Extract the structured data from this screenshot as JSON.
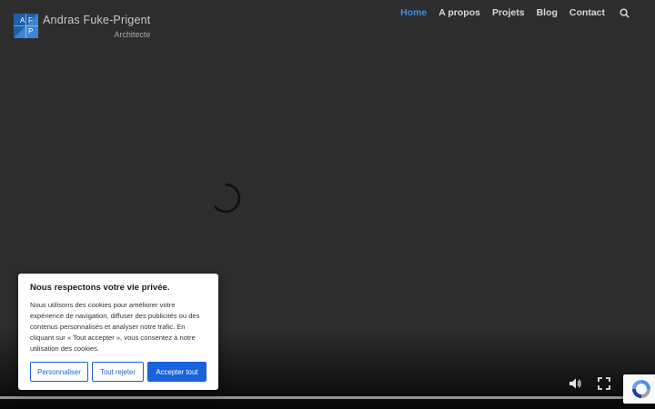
{
  "logo": {
    "mark_letters": [
      "A",
      "F",
      "P"
    ],
    "name": "Andras Fuke-Prigent",
    "subtitle": "Architecte"
  },
  "nav": {
    "items": [
      {
        "label": "Home",
        "active": true
      },
      {
        "label": "A propos",
        "active": false
      },
      {
        "label": "Projets",
        "active": false
      },
      {
        "label": "Blog",
        "active": false
      },
      {
        "label": "Contact",
        "active": false
      }
    ],
    "search_icon": "search-icon",
    "accent_color": "#3f8ee0"
  },
  "video": {
    "state": "loading",
    "controls": [
      "volume-icon",
      "fullscreen-icon"
    ]
  },
  "cookie": {
    "title": "Nous respectons votre vie privée.",
    "text": "Nous utilisons des cookies pour améliorer votre expérience de navigation, diffuser des publicités ou des contenus personnalisés et analyser notre trafic. En cliquant sur « Tout accepter », vous consentez à notre utilisation des cookies.",
    "buttons": {
      "customize": "Personnaliser",
      "reject": "Tout rejeter",
      "accept": "Accepter tout"
    },
    "button_color": "#1863dc"
  },
  "recaptcha": {
    "icon": "recaptcha-icon"
  }
}
